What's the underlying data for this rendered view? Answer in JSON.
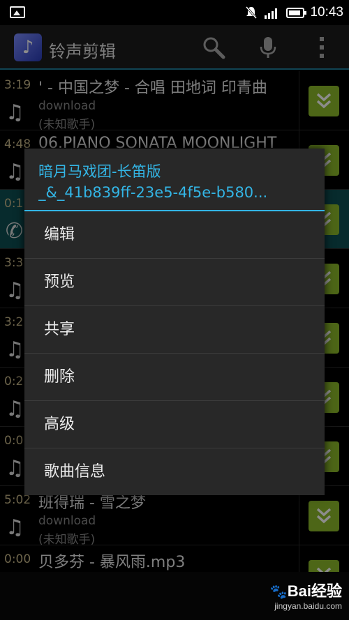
{
  "status": {
    "time": "10:43"
  },
  "app": {
    "title": "铃声剪辑"
  },
  "list": [
    {
      "duration": "3:19",
      "title": "' - 中国之梦 - 合唱 田地词 印青曲",
      "sub1": "download",
      "sub2": "(未知歌手)",
      "icon": "music-note-icon"
    },
    {
      "duration": "4:48",
      "title": "06.PIANO SONATA MOONLIGHT",
      "sub1": "",
      "sub2": "",
      "icon": "music-note-icon"
    },
    {
      "duration": "0:1",
      "title": "",
      "sub1": "",
      "sub2": "",
      "icon": "phone-icon"
    },
    {
      "duration": "3:3",
      "title": "",
      "sub1": "",
      "sub2": "",
      "icon": "music-note-icon"
    },
    {
      "duration": "3:2",
      "title": "",
      "sub1": "",
      "sub2": "",
      "icon": "music-note-icon"
    },
    {
      "duration": "0:2",
      "title": "",
      "sub1": "",
      "sub2": "",
      "icon": "music-note-icon"
    },
    {
      "duration": "0:0",
      "title": "",
      "sub1": "",
      "sub2": "",
      "icon": "music-note-icon"
    },
    {
      "duration": "5:02",
      "title": "班得瑞 - 雪之梦",
      "sub1": "download",
      "sub2": "(未知歌手)",
      "icon": "music-note-icon"
    },
    {
      "duration": "0:00",
      "title": "贝多芬 - 暴风雨.mp3",
      "sub1": "",
      "sub2": "",
      "icon": "music-note-icon"
    }
  ],
  "dialog": {
    "title_line1": "暗月马戏团-长笛版",
    "title_line2": "_&_41b839ff-23e5-4f5e-b580...",
    "items": [
      "编辑",
      "预览",
      "共享",
      "删除",
      "高级",
      "歌曲信息"
    ]
  },
  "watermark": {
    "brand": "Bai经验",
    "url": "jingyan.baidu.com"
  },
  "colors": {
    "accent": "#33b5e5",
    "expand_button": "#8dbb2a",
    "highlight_row": "#0d4f53"
  }
}
